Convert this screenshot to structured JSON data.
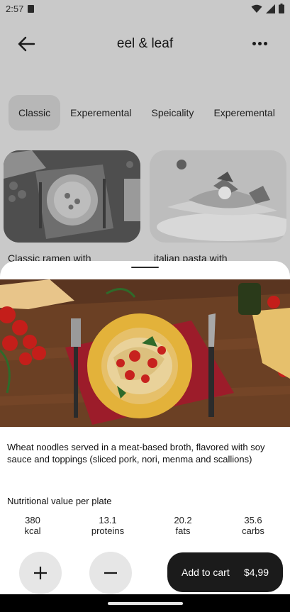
{
  "status": {
    "time": "2:57"
  },
  "appbar": {
    "title": "eel & leaf"
  },
  "tabs": [
    {
      "label": "Classic",
      "active": true
    },
    {
      "label": "Experemental",
      "active": false
    },
    {
      "label": "Speicality",
      "active": false
    },
    {
      "label": "Experemental",
      "active": false
    }
  ],
  "cards": [
    {
      "label": "Classic ramen with"
    },
    {
      "label": "italian pasta with"
    }
  ],
  "sheet": {
    "description": "Wheat noodles served in a meat-based broth, flavored with soy sauce and toppings (sliced pork, nori, menma and scallions)",
    "nutrition_title": "Nutritional value per plate",
    "nutrition": [
      {
        "value": "380",
        "unit": "kcal"
      },
      {
        "value": "13.1",
        "unit": "proteins"
      },
      {
        "value": "20.2",
        "unit": "fats"
      },
      {
        "value": "35.6",
        "unit": "carbs"
      }
    ],
    "cart": {
      "label": "Add to cart",
      "price": "$4,99"
    }
  },
  "colors": {
    "scrim": "#c9c9c9",
    "sheet": "#ffffff",
    "cart_button": "#1b1b1b"
  }
}
